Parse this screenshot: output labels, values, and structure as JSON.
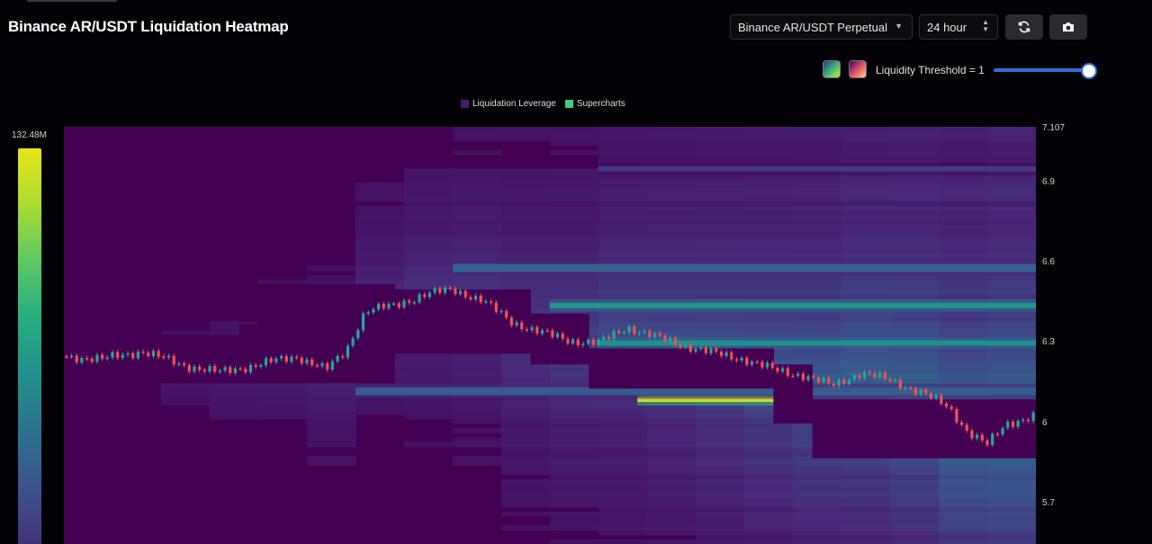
{
  "header": {
    "title": "Binance AR/USDT Liquidation Heatmap",
    "exchange_select": "Binance AR/USDT Perpetual",
    "period_select": "24 hour",
    "refresh_icon": "refresh-icon",
    "camera_icon": "camera-icon"
  },
  "controls": {
    "threshold_label": "Liquidity Threshold = 1",
    "threshold_value": 1,
    "palettes": [
      "viridis",
      "magma"
    ]
  },
  "colors": {
    "background": "#030307",
    "heat_base": "#440154",
    "candle_up": "#26a69a",
    "candle_down": "#ef5350",
    "slider": "#2f6fd8"
  },
  "chart_data": {
    "type": "heatmap",
    "title": "Binance AR/USDT Liquidation Heatmap",
    "legend": [
      {
        "name": "Liquidation Leverage",
        "color": "#4a1a6a"
      },
      {
        "name": "Supercharts",
        "color": "#3ecf7a"
      }
    ],
    "legend_position": "top-center",
    "colorbar": {
      "max_label": "132.48M",
      "min": 0,
      "max": 132.48
    },
    "y_axis": {
      "ticks": [
        "7.107",
        "6.9",
        "6.6",
        "6.3",
        "6",
        "5.7"
      ],
      "ylim": [
        5.55,
        7.107
      ]
    },
    "x_range": [
      0,
      100
    ],
    "price_path": [
      [
        0,
        6.25
      ],
      [
        4,
        6.24
      ],
      [
        8,
        6.27
      ],
      [
        12,
        6.22
      ],
      [
        16,
        6.19
      ],
      [
        20,
        6.22
      ],
      [
        24,
        6.25
      ],
      [
        27,
        6.2
      ],
      [
        29,
        6.27
      ],
      [
        31,
        6.42
      ],
      [
        34,
        6.44
      ],
      [
        37,
        6.48
      ],
      [
        40,
        6.5
      ],
      [
        43,
        6.46
      ],
      [
        46,
        6.38
      ],
      [
        49,
        6.34
      ],
      [
        52,
        6.31
      ],
      [
        55,
        6.3
      ],
      [
        58,
        6.36
      ],
      [
        61,
        6.32
      ],
      [
        64,
        6.29
      ],
      [
        67,
        6.26
      ],
      [
        70,
        6.24
      ],
      [
        73,
        6.2
      ],
      [
        76,
        6.18
      ],
      [
        79,
        6.14
      ],
      [
        82,
        6.19
      ],
      [
        85,
        6.16
      ],
      [
        88,
        6.12
      ],
      [
        91,
        6.06
      ],
      [
        93,
        5.97
      ],
      [
        95,
        5.92
      ],
      [
        97,
        6.0
      ],
      [
        100,
        6.03
      ]
    ],
    "zones": [
      {
        "x0": 0,
        "x1": 18,
        "y_low": 6.15,
        "y_high": 6.33
      },
      {
        "x0": 18,
        "x1": 34,
        "y_low": 6.15,
        "y_high": 6.37
      },
      {
        "x0": 20,
        "x1": 34,
        "y_low": 6.34,
        "y_high": 6.52
      },
      {
        "x0": 34,
        "x1": 48,
        "y_low": 6.26,
        "y_high": 6.5
      },
      {
        "x0": 48,
        "x1": 54,
        "y_low": 6.22,
        "y_high": 6.41
      },
      {
        "x0": 54,
        "x1": 73,
        "y_low": 6.13,
        "y_high": 6.28
      },
      {
        "x0": 73,
        "x1": 77,
        "y_low": 6.0,
        "y_high": 6.22
      },
      {
        "x0": 77,
        "x1": 100,
        "y_low": 5.87,
        "y_high": 6.09
      }
    ],
    "bands": [
      {
        "x0": 50,
        "x1": 100,
        "y": 6.44,
        "intensity": 0.62,
        "h": 0.02
      },
      {
        "x0": 55,
        "x1": 100,
        "y": 6.3,
        "intensity": 0.6,
        "h": 0.02
      },
      {
        "x0": 59,
        "x1": 73,
        "y": 6.09,
        "intensity": 0.96,
        "h": 0.02
      },
      {
        "x0": 40,
        "x1": 100,
        "y": 6.58,
        "intensity": 0.36,
        "h": 0.03
      },
      {
        "x0": 30,
        "x1": 100,
        "y": 6.12,
        "intensity": 0.34,
        "h": 0.03
      },
      {
        "x0": 55,
        "x1": 100,
        "y": 6.95,
        "intensity": 0.22,
        "h": 0.02
      }
    ]
  }
}
